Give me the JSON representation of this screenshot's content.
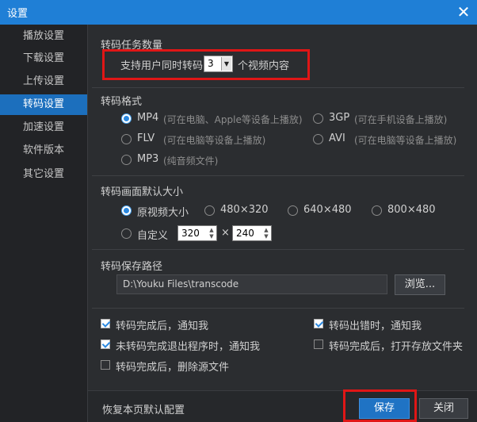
{
  "window": {
    "title": "设置",
    "close_glyph": "✕"
  },
  "sidebar": {
    "items": [
      {
        "label": "播放设置"
      },
      {
        "label": "下载设置"
      },
      {
        "label": "上传设置"
      },
      {
        "label": "转码设置"
      },
      {
        "label": "加速设置"
      },
      {
        "label": "软件版本"
      },
      {
        "label": "其它设置"
      }
    ],
    "active_index": 3
  },
  "task_count": {
    "title": "转码任务数量",
    "prefix": "支持用户同时转码",
    "value": "3",
    "suffix": "个视频内容"
  },
  "format": {
    "title": "转码格式",
    "options": [
      {
        "name": "MP4",
        "desc": "(可在电脑、Apple等设备上播放)",
        "selected": true
      },
      {
        "name": "3GP",
        "desc": "(可在手机设备上播放)",
        "selected": false
      },
      {
        "name": "FLV",
        "desc": "(可在电脑等设备上播放)",
        "selected": false
      },
      {
        "name": "AVI",
        "desc": "(可在电脑等设备上播放)",
        "selected": false
      },
      {
        "name": "MP3",
        "desc": "(纯音频文件)",
        "selected": false
      }
    ]
  },
  "size": {
    "title": "转码画面默认大小",
    "options": [
      {
        "label": "原视频大小",
        "selected": true
      },
      {
        "label": "480×320",
        "selected": false
      },
      {
        "label": "640×480",
        "selected": false
      },
      {
        "label": "800×480",
        "selected": false
      }
    ],
    "custom": {
      "label": "自定义",
      "width": "320",
      "times": "×",
      "height": "240",
      "selected": false
    }
  },
  "save_path": {
    "title": "转码保存路径",
    "value": "D:\\Youku Files\\transcode",
    "browse_label": "浏览..."
  },
  "checkboxes": [
    {
      "label": "转码完成后，通知我",
      "checked": true
    },
    {
      "label": "转码出错时，通知我",
      "checked": true
    },
    {
      "label": "未转码完成退出程序时，通知我",
      "checked": true
    },
    {
      "label": "转码完成后，打开存放文件夹",
      "checked": false
    },
    {
      "label": "转码完成后，删除源文件",
      "checked": false
    }
  ],
  "footer": {
    "restore_label": "恢复本页默认配置",
    "save_label": "保存",
    "close_label": "关闭"
  },
  "colors": {
    "titlebar": "#1f7fd6",
    "active": "#1c6fbd",
    "highlight": "#e01616"
  }
}
